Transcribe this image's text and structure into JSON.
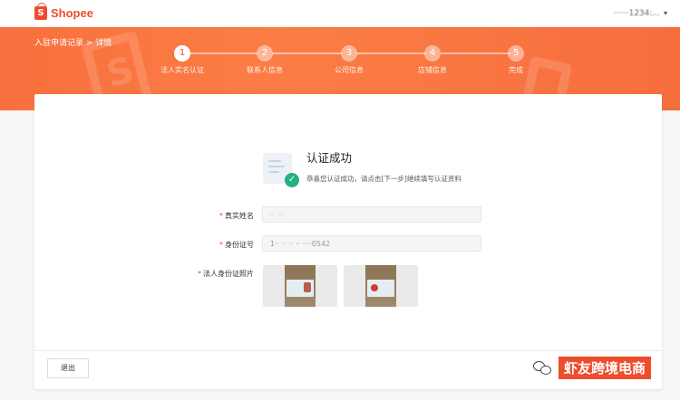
{
  "header": {
    "logo_text": "Shopee",
    "username": "······1234:...",
    "dropdown_icon": "chevron-down-icon"
  },
  "breadcrumb": "入驻申请记录 > 详情",
  "steps": [
    {
      "number": "1",
      "label": "法人实名认证",
      "active": true
    },
    {
      "number": "2",
      "label": "联系人信息",
      "active": false
    },
    {
      "number": "3",
      "label": "公司信息",
      "active": false
    },
    {
      "number": "4",
      "label": "店铺信息",
      "active": false
    },
    {
      "number": "5",
      "label": "完成",
      "active": false
    }
  ],
  "result": {
    "title": "认证成功",
    "description": "恭喜您认证成功，请点击[下一步]继续填写认证资料"
  },
  "form": {
    "required_mark": "*",
    "name_label": "真实姓名",
    "name_value": "·· ···",
    "id_label": "身份证号",
    "id_value": "1·· ·· ·· ·· ····0542",
    "photo_label": "法人身份证照片"
  },
  "footer": {
    "exit_label": "退出"
  },
  "watermark": {
    "text": "虾友跨境电商"
  },
  "colors": {
    "brand": "#ee4d2d",
    "banner": "#f8703d",
    "success": "#24b27e"
  }
}
